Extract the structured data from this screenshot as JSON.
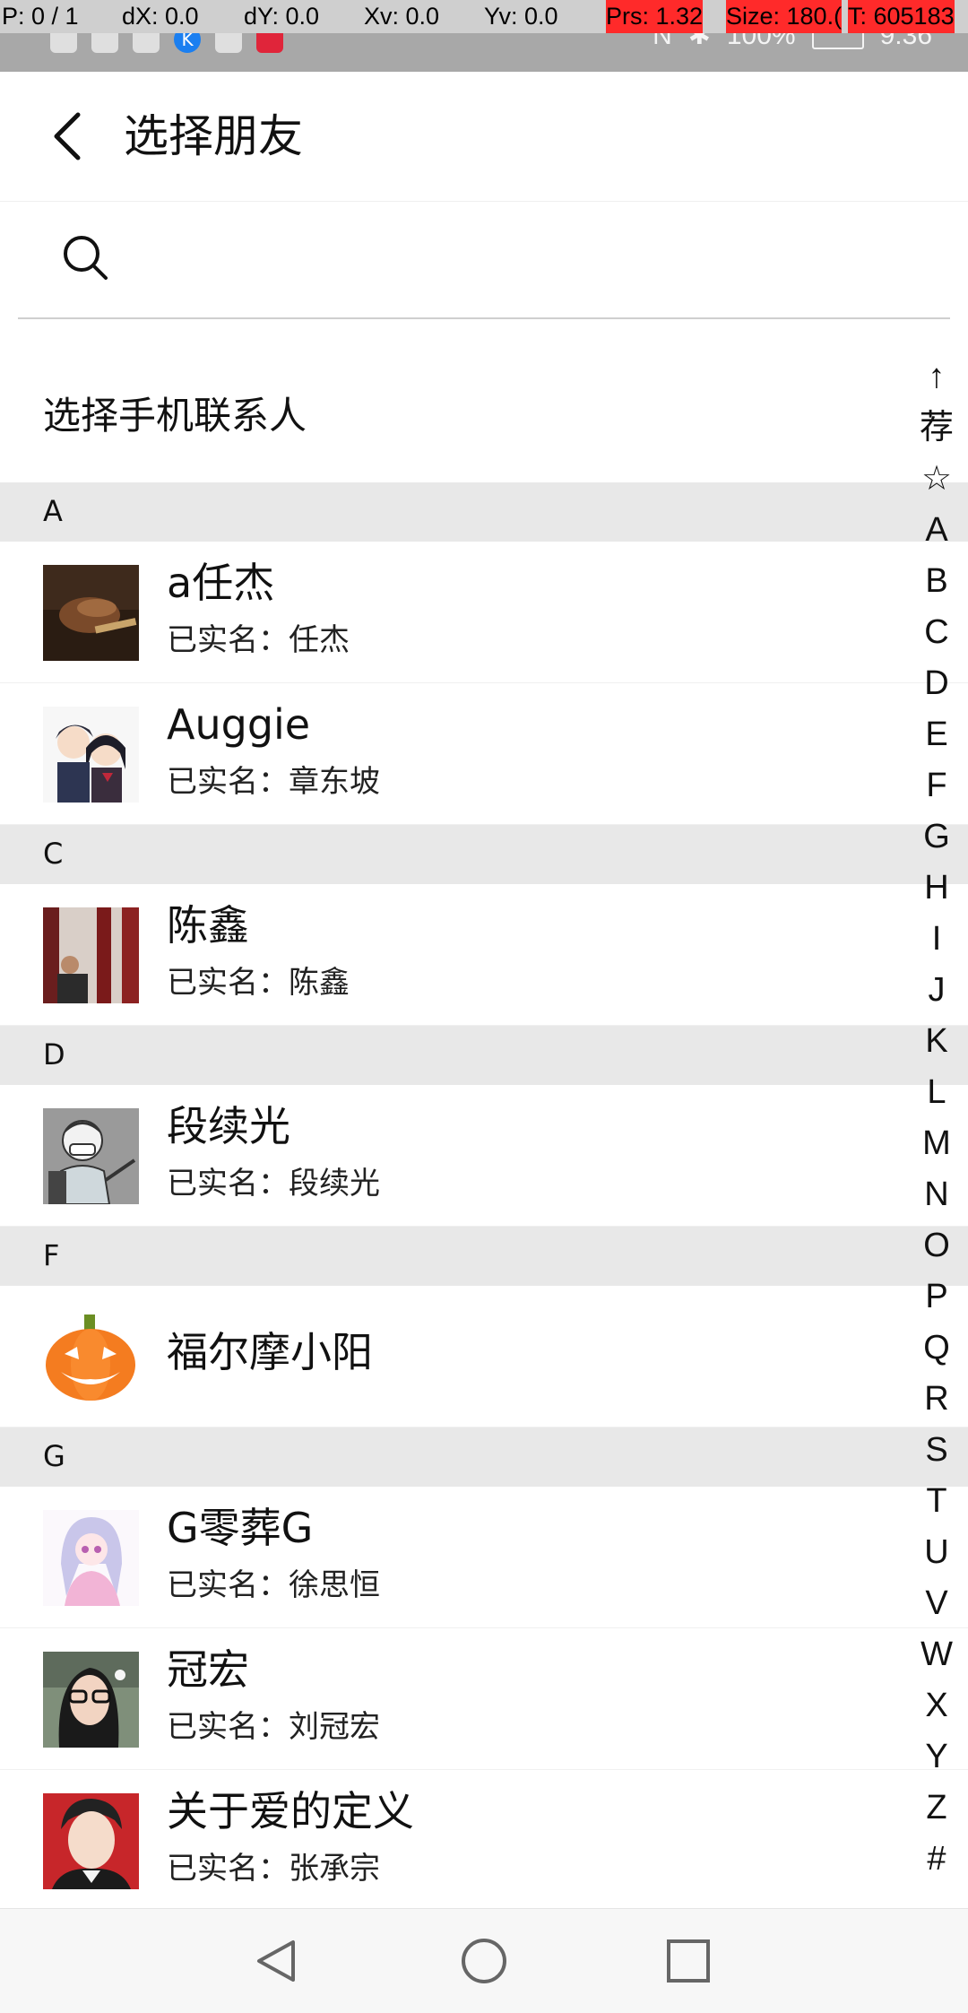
{
  "debug_overlay": {
    "p": "P: 0 / 1",
    "dx": "dX: 0.0",
    "dy": "dY: 0.0",
    "xv": "Xv: 0.0",
    "yv": "Yv: 0.0",
    "prs": "Prs: 1.32",
    "size": "Size: 180.(",
    "t": "T: 605183"
  },
  "status_bar": {
    "battery": "100%",
    "time": "9:36",
    "app_badge": "K"
  },
  "header": {
    "title": "选择朋友"
  },
  "search": {
    "value": "",
    "placeholder": ""
  },
  "phone_contacts": {
    "label": "选择手机联系人"
  },
  "sections": [
    {
      "letter": "A",
      "contacts": [
        {
          "name": "a任杰",
          "subtitle": "已实名：任杰",
          "avatar": "photo"
        },
        {
          "name": "Auggie",
          "subtitle": "已实名：章东坡",
          "avatar": "anime-couple"
        }
      ]
    },
    {
      "letter": "C",
      "contacts": [
        {
          "name": "陈鑫",
          "subtitle": "已实名：陈鑫",
          "avatar": "photo"
        }
      ]
    },
    {
      "letter": "D",
      "contacts": [
        {
          "name": "段续光",
          "subtitle": "已实名：段续光",
          "avatar": "cartoon"
        }
      ]
    },
    {
      "letter": "F",
      "contacts": [
        {
          "name": "福尔摩小阳",
          "subtitle": "",
          "avatar": "pumpkin"
        }
      ]
    },
    {
      "letter": "G",
      "contacts": [
        {
          "name": "G零葬G",
          "subtitle": "已实名：徐思恒",
          "avatar": "anime-girl"
        },
        {
          "name": "冠宏",
          "subtitle": "已实名：刘冠宏",
          "avatar": "photo"
        },
        {
          "name": "关于爱的定义",
          "subtitle": "已实名：张承宗",
          "avatar": "photo"
        }
      ]
    }
  ],
  "index_bar": [
    "↑",
    "荐",
    "☆",
    "A",
    "B",
    "C",
    "D",
    "E",
    "F",
    "G",
    "H",
    "I",
    "J",
    "K",
    "L",
    "M",
    "N",
    "O",
    "P",
    "Q",
    "R",
    "S",
    "T",
    "U",
    "V",
    "W",
    "X",
    "Y",
    "Z",
    "#"
  ],
  "colors": {
    "section_bg": "#e8e8e8",
    "status_bar_bg": "#a8a8a8",
    "debug_highlight": "#ff2a2a"
  },
  "icons": {
    "back": "chevron-left-icon",
    "search": "search-icon",
    "nav_back": "triangle-back-icon",
    "nav_home": "circle-home-icon",
    "nav_recents": "square-recents-icon"
  }
}
